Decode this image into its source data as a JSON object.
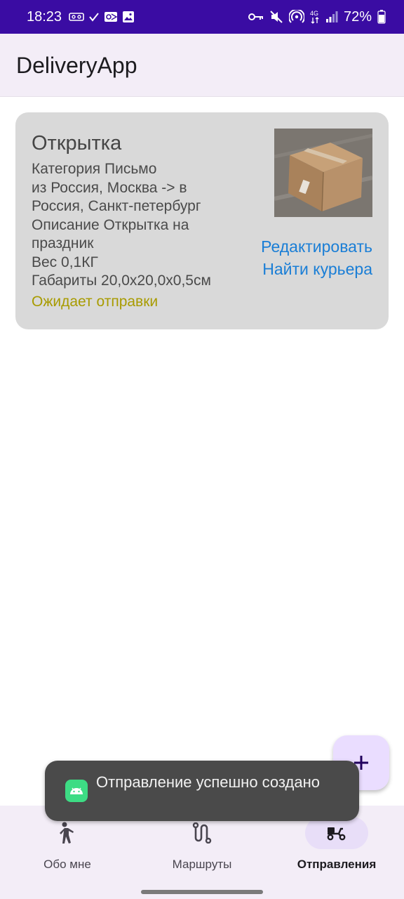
{
  "status_bar": {
    "time": "18:23",
    "battery_percent": "72%",
    "left_icons": [
      "voicemail-icon",
      "check-icon",
      "outlook-icon",
      "gallery-icon"
    ],
    "right_icons": [
      "key-icon",
      "mute-icon",
      "hotspot-icon",
      "network-4g-icon",
      "signal-icon",
      "battery-icon"
    ],
    "background": "#3a0ca3"
  },
  "app_bar": {
    "title": "DeliveryApp"
  },
  "card": {
    "title": "Открытка",
    "category": "Категория Письмо",
    "route": "из Россия, Москва -> в Россия, Санкт-петербург",
    "description": "Описание Открытка на праздник",
    "weight": "Вес 0,1КГ",
    "dimensions": "Габариты 20,0x20,0x0,5см",
    "status": "Ожидает отправки",
    "status_color": "#a89b00",
    "edit_label": "Редактировать",
    "find_courier_label": "Найти курьера",
    "link_color": "#1a7ed6",
    "image": "cardboard-box-photo"
  },
  "fab": {
    "icon": "plus-icon"
  },
  "toast": {
    "message": "Отправление успешно создано",
    "icon": "android-icon"
  },
  "bottom_nav": {
    "items": [
      {
        "label": "Обо мне",
        "icon": "person-icon",
        "active": false
      },
      {
        "label": "Маршруты",
        "icon": "route-icon",
        "active": false
      },
      {
        "label": "Отправления",
        "icon": "scooter-icon",
        "active": true
      }
    ]
  }
}
